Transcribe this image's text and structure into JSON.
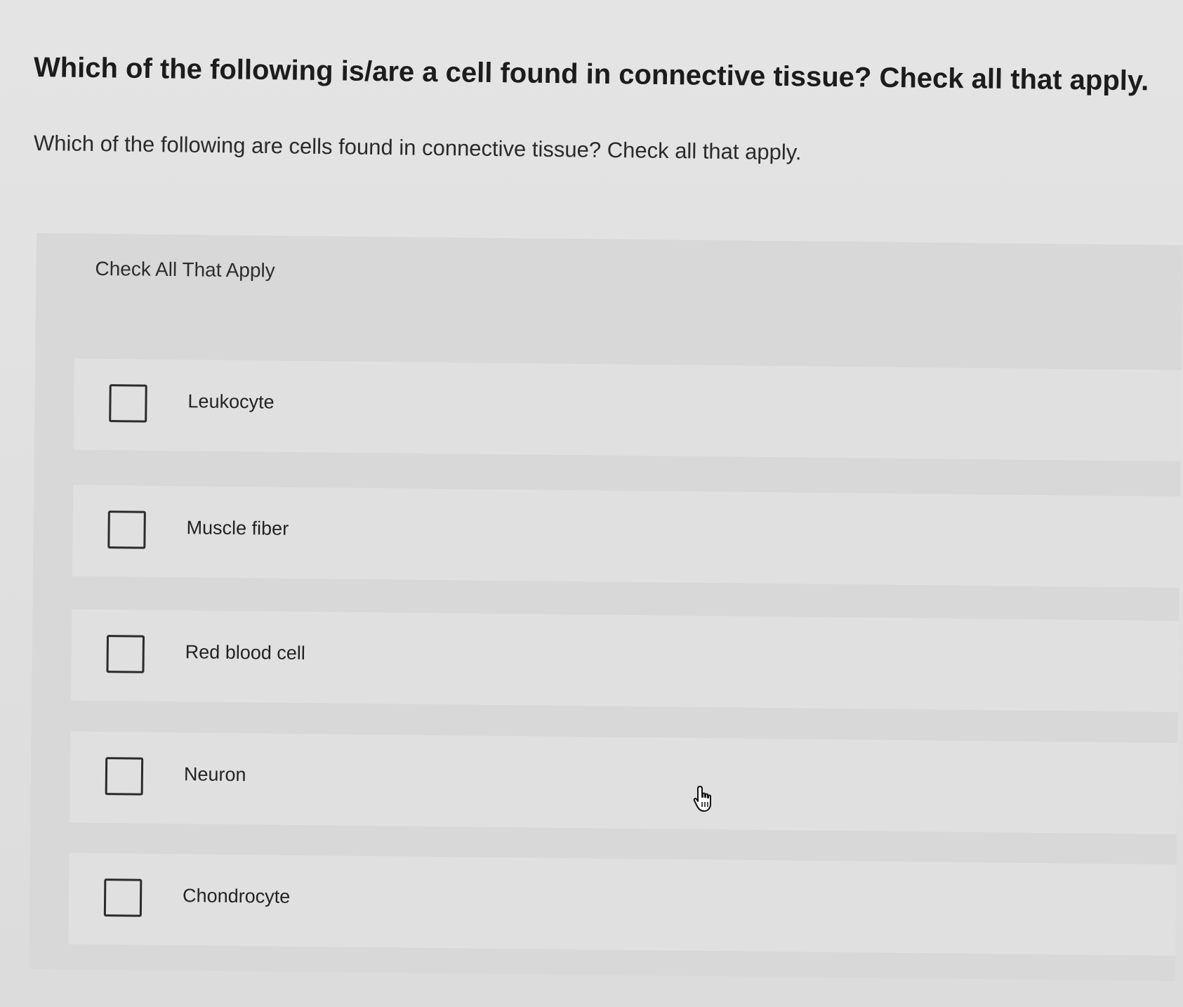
{
  "question": {
    "title": "Which of the following is/are a cell found in connective tissue? Check all that apply.",
    "prompt": "Which of the following are cells found in connective tissue? Check all that apply."
  },
  "answer_panel": {
    "header": "Check All That Apply",
    "options": [
      {
        "label": "Leukocyte",
        "checked": false
      },
      {
        "label": "Muscle fiber",
        "checked": false
      },
      {
        "label": "Red blood cell",
        "checked": false
      },
      {
        "label": "Neuron",
        "checked": false
      },
      {
        "label": "Chondrocyte",
        "checked": false
      }
    ]
  },
  "pointer": {
    "icon": "hand-pointer-icon"
  }
}
